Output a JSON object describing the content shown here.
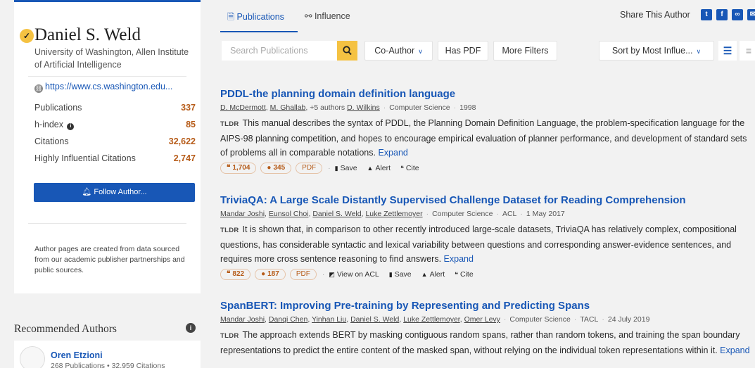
{
  "author": {
    "name": "Daniel S. Weld",
    "affiliation": "University of Washington, Allen Institute of Artificial Intelligence",
    "url": "https://www.cs.washington.edu...",
    "stats": [
      {
        "label": "Publications",
        "value": "337"
      },
      {
        "label": "h-index",
        "value": "85"
      },
      {
        "label": "Citations",
        "value": "32,622"
      },
      {
        "label": "Highly Influential Citations",
        "value": "2,747"
      }
    ],
    "follow_label": "Follow Author...",
    "note": "Author pages are created from data sourced from our academic publisher partnerships and public sources."
  },
  "recommended": {
    "title": "Recommended Authors",
    "items": [
      {
        "name": "Oren Etzioni",
        "meta": "268 Publications • 32,959 Citations"
      }
    ]
  },
  "tabs": [
    {
      "label": "Publications",
      "icon": "document-icon"
    },
    {
      "label": "Influence",
      "icon": "network-icon"
    }
  ],
  "share": {
    "label": "Share This Author"
  },
  "toolbar": {
    "search_placeholder": "Search Publications",
    "coauthor_label": "Co-Author",
    "haspdf_label": "Has PDF",
    "morefilters_label": "More Filters",
    "sort_label": "Sort by Most Influe..."
  },
  "papers": [
    {
      "title": "PDDL-the planning domain definition language",
      "authors": [
        "D. McDermott",
        "M. Ghallab"
      ],
      "more_authors": "+5 authors",
      "last_author": "D. Wilkins",
      "field": "Computer Science",
      "venue": "",
      "date": "1998",
      "tldr": "This manual describes the syntax of PDDL, the Planning Domain Definition Language, the problem-specification language for the AIPS-98 planning competition, and hopes to encourage empirical evaluation of planner performance, and development of standard sets of problems all in comparable notations.",
      "citations": "1,704",
      "influential": "345",
      "view_label": ""
    },
    {
      "title": "TriviaQA: A Large Scale Distantly Supervised Challenge Dataset for Reading Comprehension",
      "authors": [
        "Mandar Joshi",
        "Eunsol Choi",
        "Daniel S. Weld",
        "Luke Zettlemoyer"
      ],
      "field": "Computer Science",
      "venue": "ACL",
      "date": "1 May 2017",
      "tldr": "It is shown that, in comparison to other recently introduced large-scale datasets, TriviaQA has relatively complex, compositional questions, has considerable syntactic and lexical variability between questions and corresponding answer-evidence sentences, and requires more cross sentence reasoning to find answers.",
      "citations": "822",
      "influential": "187",
      "view_label": "View on ACL"
    },
    {
      "title": "SpanBERT: Improving Pre-training by Representing and Predicting Spans",
      "authors": [
        "Mandar Joshi",
        "Danqi Chen",
        "Yinhan Liu",
        "Daniel S. Weld",
        "Luke Zettlemoyer",
        "Omer Levy"
      ],
      "field": "Computer Science",
      "venue": "TACL",
      "date": "24 July 2019",
      "tldr": "The approach extends BERT by masking contiguous random spans, rather than random tokens, and training the span boundary representations to predict the entire content of the masked span, without relying on the individual token representations within it."
    }
  ],
  "labels": {
    "tldr": "TLDR",
    "expand": "Expand",
    "pdf": "PDF",
    "save": "Save",
    "alert": "Alert",
    "cite": "Cite"
  },
  "colors": {
    "accent": "#1857b6",
    "highlight": "#f5c242",
    "stat": "#b65b18"
  }
}
